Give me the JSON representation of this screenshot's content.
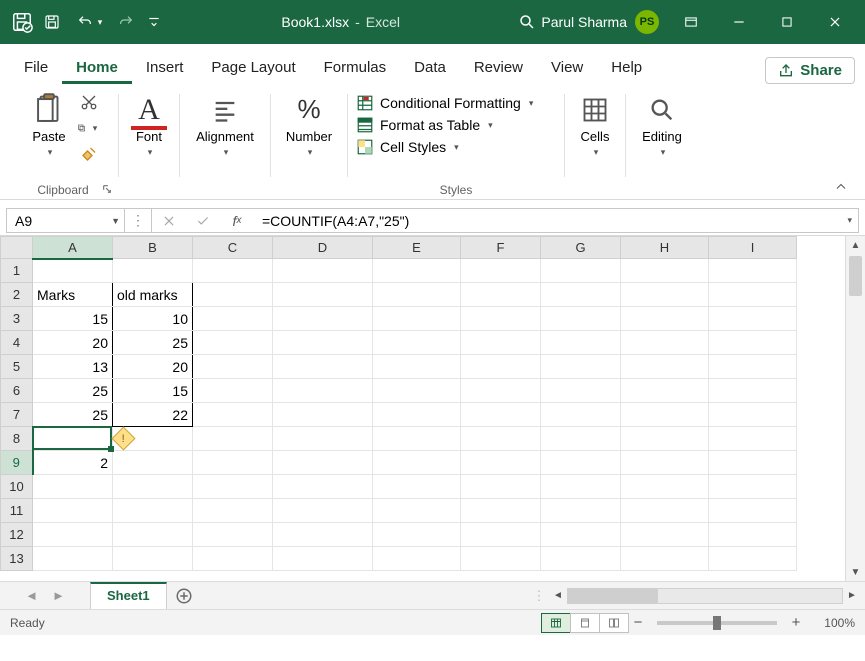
{
  "title": {
    "filename": "Book1.xlsx",
    "separator": "-",
    "app": "Excel"
  },
  "user": {
    "name": "Parul Sharma",
    "initials": "PS"
  },
  "tabs": {
    "items": [
      "File",
      "Home",
      "Insert",
      "Page Layout",
      "Formulas",
      "Data",
      "Review",
      "View",
      "Help"
    ],
    "active": "Home",
    "share": "Share"
  },
  "ribbon": {
    "clipboard": {
      "paste": "Paste",
      "label": "Clipboard"
    },
    "font": {
      "btn": "Font"
    },
    "alignment": {
      "btn": "Alignment"
    },
    "number": {
      "btn": "Number"
    },
    "styles": {
      "cond": "Conditional Formatting",
      "table": "Format as Table",
      "cell": "Cell Styles",
      "label": "Styles"
    },
    "cells": {
      "btn": "Cells"
    },
    "editing": {
      "btn": "Editing"
    }
  },
  "formula": {
    "name_box": "A9",
    "formula": "=COUNTIF(A4:A7,\"25\")"
  },
  "sheet": {
    "columns": [
      "A",
      "B",
      "C",
      "D",
      "E",
      "F",
      "G",
      "H",
      "I"
    ],
    "visible_rows": 13,
    "data": {
      "A2": "Marks",
      "B2": "old marks",
      "A3": "15",
      "B3": "10",
      "A4": "20",
      "B4": "25",
      "A5": "13",
      "B5": "20",
      "A6": "25",
      "B6": "15",
      "A7": "25",
      "B7": "22",
      "A9": "2"
    },
    "active": {
      "cell": "A9",
      "row": 9,
      "col": "A"
    },
    "tabs": {
      "active": "Sheet1"
    }
  },
  "status": {
    "mode": "Ready",
    "zoom": "100%"
  },
  "chart_data": {
    "type": "table",
    "title": "",
    "columns": [
      "Marks",
      "old marks"
    ],
    "rows": [
      [
        15,
        10
      ],
      [
        20,
        25
      ],
      [
        13,
        20
      ],
      [
        25,
        15
      ],
      [
        25,
        22
      ]
    ],
    "derived": {
      "cell": "A9",
      "formula": "=COUNTIF(A4:A7,\"25\")",
      "value": 2
    }
  }
}
